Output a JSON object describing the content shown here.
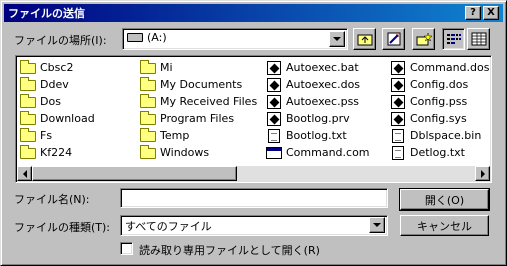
{
  "window": {
    "title": "ファイルの送信"
  },
  "titlebar": {
    "help_glyph": "?",
    "close_glyph": "X"
  },
  "location": {
    "label": "ファイルの場所(I):",
    "value": "(A:)"
  },
  "files": [
    {
      "name": "Cbsc2",
      "type": "folder"
    },
    {
      "name": "Ddev",
      "type": "folder"
    },
    {
      "name": "Dos",
      "type": "folder"
    },
    {
      "name": "Download",
      "type": "folder"
    },
    {
      "name": "Fs",
      "type": "folder"
    },
    {
      "name": "Kf224",
      "type": "folder"
    },
    {
      "name": "Mi",
      "type": "folder"
    },
    {
      "name": "My Documents",
      "type": "folder"
    },
    {
      "name": "My Received Files",
      "type": "folder"
    },
    {
      "name": "Program Files",
      "type": "folder"
    },
    {
      "name": "Temp",
      "type": "folder"
    },
    {
      "name": "Windows",
      "type": "folder"
    },
    {
      "name": "Autoexec.bat",
      "type": "system"
    },
    {
      "name": "Autoexec.dos",
      "type": "system"
    },
    {
      "name": "Autoexec.pss",
      "type": "system"
    },
    {
      "name": "Bootlog.prv",
      "type": "system"
    },
    {
      "name": "Bootlog.txt",
      "type": "text"
    },
    {
      "name": "Command.com",
      "type": "exe"
    },
    {
      "name": "Command.dos",
      "type": "system"
    },
    {
      "name": "Config.dos",
      "type": "system"
    },
    {
      "name": "Config.pss",
      "type": "system"
    },
    {
      "name": "Config.sys",
      "type": "system"
    },
    {
      "name": "Dblspace.bin",
      "type": "text"
    },
    {
      "name": "Detlog.txt",
      "type": "text"
    }
  ],
  "filename": {
    "label": "ファイル名(N):",
    "value": ""
  },
  "filetype": {
    "label": "ファイルの種類(T):",
    "value": "すべてのファイル"
  },
  "buttons": {
    "open": "開く(O)",
    "cancel": "キャンセル"
  },
  "readonly": {
    "label": "読み取り専用ファイルとして開く(R)",
    "checked": false
  },
  "colors": {
    "titlebar_start": "#000080",
    "titlebar_end": "#1084d0",
    "face": "#c0c0c0"
  }
}
